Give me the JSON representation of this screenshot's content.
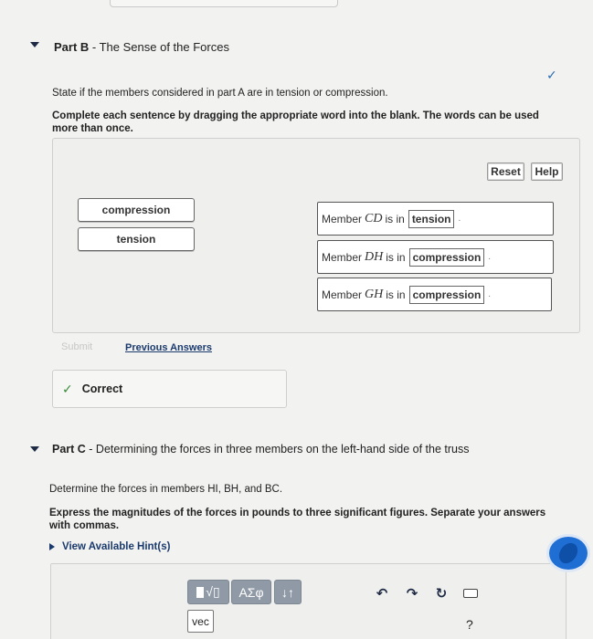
{
  "partB": {
    "label": "Part B",
    "title": " - The Sense of the Forces",
    "instruction": "State if the members considered in part A are in tension or compression.",
    "directions": "Complete each sentence by dragging the appropriate word into the blank. The words can be used more than once.",
    "reset_label": "Reset",
    "help_label": "Help",
    "word_bank": [
      "compression",
      "tension"
    ],
    "sentences": [
      {
        "prefix": "Member",
        "member": "CD",
        "middle": "is in",
        "answer": "tension"
      },
      {
        "prefix": "Member",
        "member": "DH",
        "middle": "is in",
        "answer": "compression"
      },
      {
        "prefix": "Member",
        "member": "GH",
        "middle": "is in",
        "answer": "compression"
      }
    ],
    "submit_label": "Submit",
    "previous_answers_label": "Previous Answers",
    "correct_label": "Correct"
  },
  "partC": {
    "label": "Part C",
    "title": " - Determining the forces in three members on the left-hand side of the truss",
    "instruction": "Determine the forces in members HI, BH, and BC.",
    "directions": "Express the magnitudes of the forces in pounds to three significant figures. Separate your answers with commas.",
    "hint_label": "View Available Hint(s)",
    "toolbar": {
      "templates_label": "√▯",
      "symbols_label": "ΑΣφ",
      "sort_label": "↓↑",
      "vec_label": "vec",
      "help_label": "?"
    }
  }
}
